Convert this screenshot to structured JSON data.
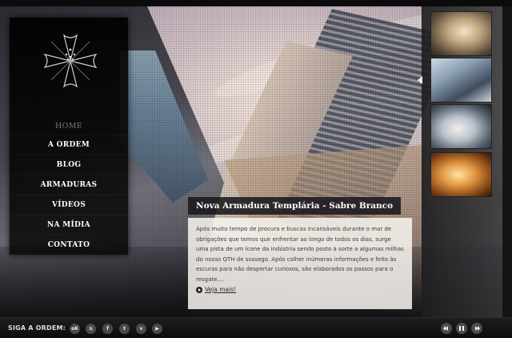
{
  "nav": {
    "items": [
      {
        "label": "HOME",
        "active": true
      },
      {
        "label": "A ORDEM"
      },
      {
        "label": "BLOG"
      },
      {
        "label": "ARMADURAS"
      },
      {
        "label": "VÍDEOS"
      },
      {
        "label": "NA MÍDIA"
      },
      {
        "label": "CONTATO"
      }
    ]
  },
  "article": {
    "title": "Nova Armadura Templária - Sabre Branco",
    "body": "Após muito tempo de procura e buscas incansáveis durante o mar de obrigações que temos que enfrentar ao longo de todos os dias, surge uma pista de um ícone da indústria sendo posto à sorte a algumas milhas do nosso QTH de sossego. Após colher inúmeras informações e feito às escuras para não despertar curiosos, são elaborados os passos para o resgate....",
    "read_more": "Veja mais!"
  },
  "footer": {
    "follow_label": "SIGA A ORDEM:",
    "social": [
      {
        "icon": "orkut-icon",
        "glyph": "oK"
      },
      {
        "icon": "rss-icon",
        "glyph": "≋"
      },
      {
        "icon": "facebook-icon",
        "glyph": "f"
      },
      {
        "icon": "twitter-icon",
        "glyph": "t"
      },
      {
        "icon": "vimeo-icon",
        "glyph": "v"
      },
      {
        "icon": "youtube-icon",
        "glyph": "▶"
      }
    ]
  },
  "colors": {
    "panel": "#000000",
    "nav_inactive": "#777777",
    "article_box": "#f8f4f0"
  }
}
